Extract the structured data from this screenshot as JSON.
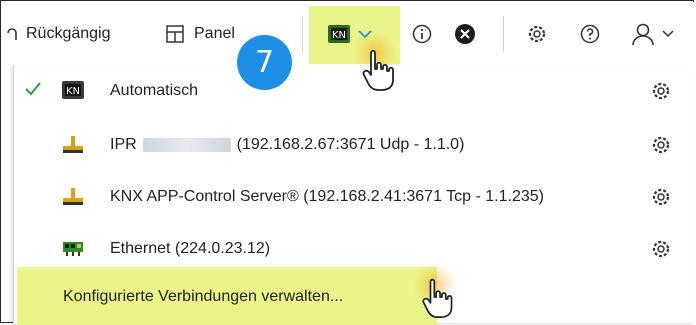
{
  "toolbar": {
    "undo_label": "Rückgängig",
    "panel_label": "Panel",
    "step_number": "7"
  },
  "menu": {
    "items": [
      {
        "label": "Automatisch",
        "checked": true,
        "icon": "knx-auto-icon"
      },
      {
        "label_prefix": "IPR",
        "label_suffix": "(192.168.2.67:3671 Udp - 1.1.0)",
        "icon": "network-connector-icon"
      },
      {
        "label": "KNX APP-Control Server® (192.168.2.41:3671 Tcp - 1.1.235)",
        "icon": "network-connector-icon"
      },
      {
        "label": "Ethernet (224.0.23.12)",
        "icon": "ethernet-card-icon"
      }
    ],
    "manage_label": "Konfigurierte Verbindungen verwalten..."
  },
  "colors": {
    "highlight": "#eaf48a",
    "badge": "#1f8fe6",
    "check": "#2e9e3e"
  }
}
